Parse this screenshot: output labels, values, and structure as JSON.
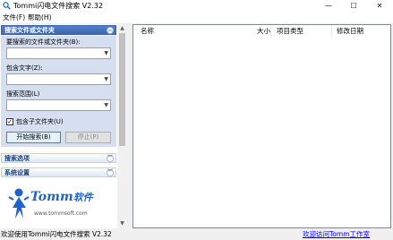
{
  "window": {
    "title": "Tommi闪电文件搜索 V2.32",
    "minimize_glyph": "—",
    "maximize_glyph": "☐",
    "close_glyph": "✕"
  },
  "menu": {
    "items": [
      {
        "label": "文件(F)"
      },
      {
        "label": "帮助(H)"
      }
    ]
  },
  "search_section": {
    "title": "搜索文件或文件夹",
    "toggle_glyph": "︽",
    "fields": [
      {
        "label": "要搜索的文件或文件夹(B):",
        "value": ""
      },
      {
        "label": "包含文字(Z):",
        "value": ""
      },
      {
        "label": "搜索范围(L)",
        "value": ""
      }
    ],
    "include_subfolders_label": "包含子文件夹(U)",
    "include_subfolders_checked": true,
    "check_glyph": "✓",
    "start_button_label": "开始搜索(B)",
    "stop_button_label": "停止(P)"
  },
  "options_section": {
    "title": "搜索选项",
    "toggle_glyph": "︾"
  },
  "settings_section": {
    "title": "系统设置",
    "toggle_glyph": "︾"
  },
  "logo": {
    "brand": "Tomm",
    "brand_cn": "软件",
    "url": "www.tommsoft.com"
  },
  "scrollbar": {
    "up_glyph": "▲",
    "down_glyph": "▼"
  },
  "results": {
    "columns": [
      "名称",
      "大小",
      "项目类型",
      "修改日期"
    ]
  },
  "status": {
    "message": "欢迎使用Tommi闪电文件搜索 V2.32",
    "link_label": "欢迎访问Tomm工作室"
  },
  "colors": {
    "accent": "#3c64b4",
    "panel_bg": "#d5dff0",
    "link": "#0000ff"
  }
}
